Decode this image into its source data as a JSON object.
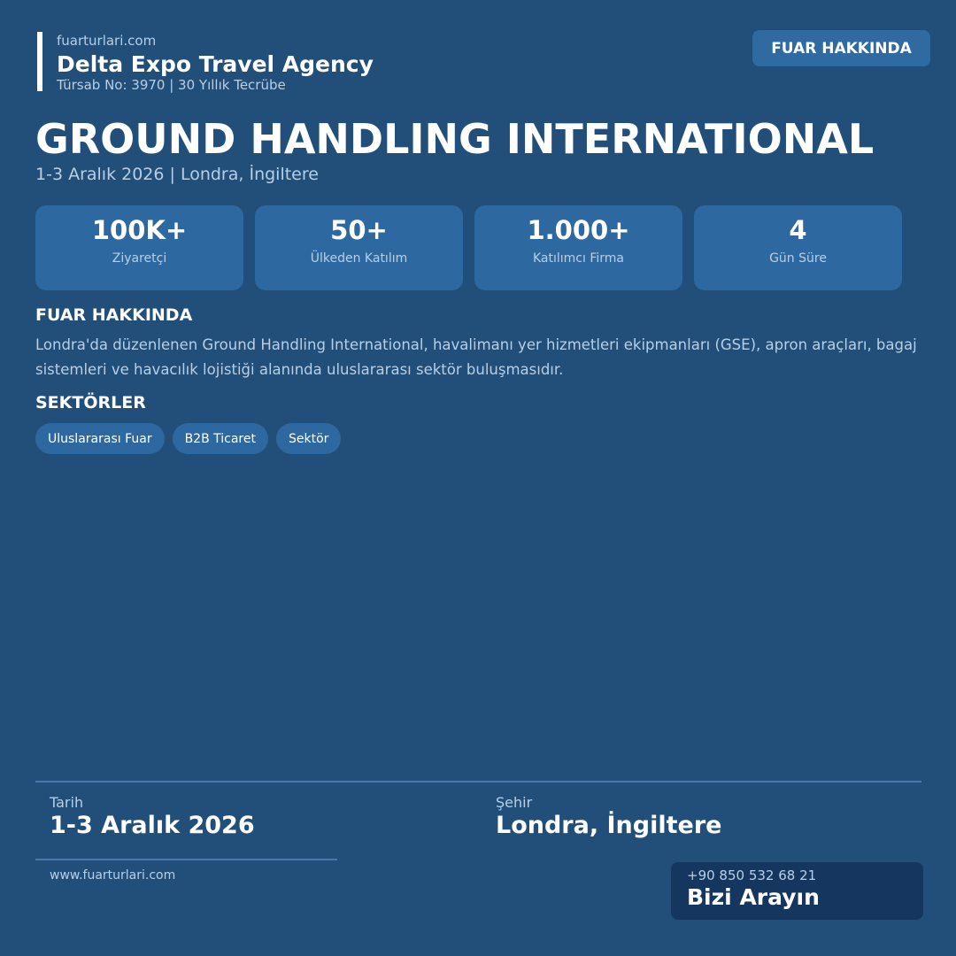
{
  "header": {
    "site": "fuarturlari.com",
    "agency_name": "Delta Expo Travel Agency",
    "tursab_line": "Türsab No: 3970  |  30 Yıllık Tecrübe",
    "tag_button": "FUAR HAKKINDA"
  },
  "event": {
    "title": "GROUND HANDLING INTERNATIONAL",
    "subtitle": "1-3 Aralık 2026  |  Londra, İngiltere"
  },
  "stats": [
    {
      "value": "100K+",
      "label": "Ziyaretçi"
    },
    {
      "value": "50+",
      "label": "Ülkeden Katılım"
    },
    {
      "value": "1.000+",
      "label": "Katılımcı Firma"
    },
    {
      "value": "4",
      "label": "Gün Süre"
    }
  ],
  "about": {
    "heading": "FUAR HAKKINDA",
    "text": "Londra'da düzenlenen Ground Handling International, havalimanı yer hizmetleri ekipmanları (GSE), apron araçları, bagaj sistemleri ve havacılık lojistiği alanında uluslararası sektör buluşmasıdır."
  },
  "sectors": {
    "heading": "SEKTÖRLER",
    "chips": [
      "Uluslararası Fuar",
      "B2B Ticaret",
      "Sektör"
    ]
  },
  "footer": {
    "date_label": "Tarih",
    "date_value": "1-3 Aralık 2026",
    "city_label": "Şehir",
    "city_value": "Londra, İngiltere",
    "website": "www.fuarturlari.com",
    "phone": "+90 850 532 68 21",
    "call_label": "Bizi Arayın"
  },
  "colors": {
    "background": "#214f79",
    "card": "#2e68a0",
    "muted_text": "#b8cfe6",
    "call_box": "#15375f"
  }
}
